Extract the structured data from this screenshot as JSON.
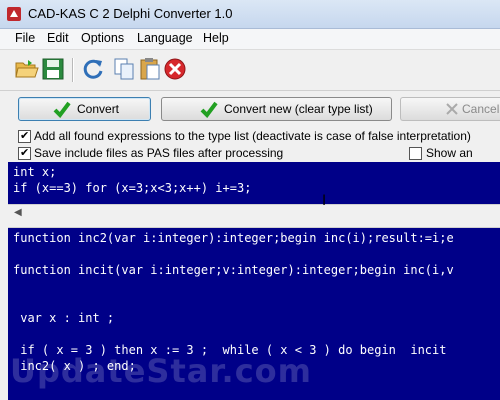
{
  "window": {
    "title": "CAD-KAS C 2 Delphi Converter 1.0"
  },
  "menu": [
    "File",
    "Edit",
    "Options",
    "Language",
    "Help"
  ],
  "toolbar": {
    "icons": [
      "open-folder-icon",
      "save-icon",
      "refresh-icon",
      "copy-icon",
      "paste-icon",
      "delete-icon"
    ]
  },
  "buttons": {
    "convert": "Convert",
    "convert_new": "Convert new (clear type list)",
    "cancel": "Cancel"
  },
  "options": {
    "add_expressions": {
      "label": "Add all found expressions to the type list (deactivate is case of false interpretation)",
      "checked": true
    },
    "save_include": {
      "label": "Save include files as PAS files after processing",
      "checked": true
    },
    "show_error": {
      "label": "Show an error m",
      "checked": false
    }
  },
  "input_code": [
    "int x;",
    "if (x==3) for (x=3;x<3;x++) i+=3;"
  ],
  "output_code": [
    "function inc2(var i:integer):integer;begin inc(i);result:=i;e",
    "",
    "function incit(var i:integer;v:integer):integer;begin inc(i,v",
    "",
    "",
    " var x : int ;",
    "",
    " if ( x = 3 ) then x := 3 ;  while ( x < 3 ) do begin  incit",
    " inc2( x ) ; end;"
  ],
  "watermark": "UpdateStar.com"
}
